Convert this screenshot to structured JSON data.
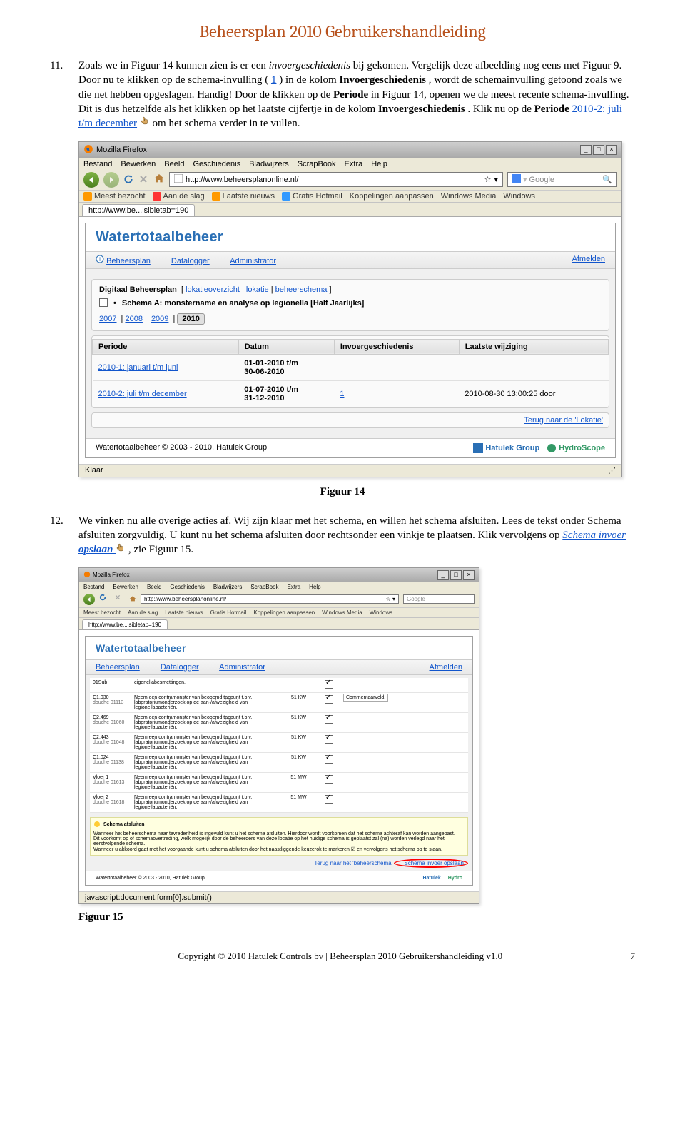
{
  "doc_title": "Beheersplan 2010 Gebruikershandleiding",
  "item11": {
    "num": "11.",
    "text_parts": {
      "p1": "Zoals we in Figuur 14 kunnen zien is er een ",
      "p2_italic": "invoergeschiedenis",
      "p3": " bij gekomen. Vergelijk deze afbeelding nog eens met Figuur 9. Door nu te klikken op de schema-invulling (",
      "p4_link": "1",
      "p5": ") in de kolom ",
      "p6_bold": "Invoergeschiedenis",
      "p7": ", wordt de schemainvulling getoond zoals we die net hebben opgeslagen. Handig! Door de klikken op de ",
      "p8_bold": "Periode",
      "p9": " in Figuur 14, openen we de meest recente schema-invulling. Dit is dus hetzelfde als het klikken op het laatste cijfertje in de kolom ",
      "p10_bold": "Invoergeschiedenis",
      "p11": ". Klik nu op de ",
      "p12_bold": "Periode ",
      "p13_link": "2010-2: juli t/m december",
      "p14": " om het schema verder in te vullen."
    }
  },
  "fig14": {
    "caption": "Figuur 14",
    "window_title": "Mozilla Firefox",
    "menus": [
      "Bestand",
      "Bewerken",
      "Beeld",
      "Geschiedenis",
      "Bladwijzers",
      "ScrapBook",
      "Extra",
      "Help"
    ],
    "url": "http://www.beheersplanonline.nl/",
    "search_placeholder": "Google",
    "bookmarks": [
      "Meest bezocht",
      "Aan de slag",
      "Laatste nieuws",
      "Gratis Hotmail",
      "Koppelingen aanpassen",
      "Windows Media",
      "Windows"
    ],
    "tab": "http://www.be...isibletab=190",
    "app_title": "Watertotaalbeheer",
    "nav_left": [
      "Beheersplan",
      "Datalogger",
      "Administrator"
    ],
    "nav_right": "Afmelden",
    "breadcrumb_label": "Digitaal Beheersplan",
    "breadcrumb_links": [
      "lokatieoverzicht",
      "lokatie",
      "beheerschema"
    ],
    "schema_bullet": "•",
    "schema_label": "Schema A: monstername en analyse op legionella [Half Jaarlijks]",
    "years_links": [
      "2007",
      "2008",
      "2009"
    ],
    "year_selected": "2010",
    "table": {
      "cols": [
        "Periode",
        "Datum",
        "Invoergeschiedenis",
        "Laatste wijziging"
      ],
      "rows": [
        {
          "periode": "2010-1: januari t/m juni",
          "datum": "01-01-2010 t/m\n30-06-2010",
          "inv": "",
          "laatste": ""
        },
        {
          "periode": "2010-2: juli t/m december",
          "datum": "01-07-2010 t/m\n31-12-2010",
          "inv": "1",
          "laatste": "2010-08-30 13:00:25 door"
        }
      ]
    },
    "return_link": "Terug naar de 'Lokatie'",
    "footer_copyright": "Watertotaalbeheer © 2003 - 2010, Hatulek Group",
    "brand1": "Hatulek Group",
    "brand2": "HydroScope",
    "status": "Klaar"
  },
  "item12": {
    "num": "12.",
    "text_parts": {
      "p1": "We vinken nu alle overige acties af. Wij zijn klaar met het schema, en willen het schema afsluiten. Lees de tekst onder Schema afsluiten zorgvuldig. U kunt nu het schema afsluiten door rechtsonder een vinkje te plaatsen. Klik vervolgens op ",
      "p2_link": "Schema invoer ",
      "p3_linkbold": "opslaan",
      "p4": ", zie Figuur 15."
    }
  },
  "fig15": {
    "caption": "Figuur 15",
    "window_title": "Mozilla Firefox",
    "menus": [
      "Bestand",
      "Bewerken",
      "Beeld",
      "Geschiedenis",
      "Bladwijzers",
      "ScrapBook",
      "Extra",
      "Help"
    ],
    "url": "http://www.beheersplanonline.nl/",
    "search_placeholder": "Google",
    "bookmarks": [
      "Meest bezocht",
      "Aan de slag",
      "Laatste nieuws",
      "Gratis Hotmail",
      "Koppelingen aanpassen",
      "Windows Media",
      "Windows"
    ],
    "tab": "http://www.be...isibletab=190",
    "app_title": "Watertotaalbeheer",
    "nav_left": [
      "Beheersplan",
      "Datalogger",
      "Administrator"
    ],
    "nav_right": "Afmelden",
    "rows": [
      {
        "code": "01Sub",
        "extra": "",
        "desc": "eigenellabesmettingen.",
        "val": "",
        "ch": true,
        "note": ""
      },
      {
        "code": "C1.030",
        "extra": "douche 01113",
        "desc": "Neem een contramonster van beooemd tappunt t.b.v. laboratoriumonderzoek op de aan-/afwezigheid van legionellabacteriën.",
        "val": "51  KW",
        "ch": true,
        "note": "Commentaarveld."
      },
      {
        "code": "C2.469",
        "extra": "douche 01060",
        "desc": "Neem een contramonster van beooemd tappunt t.b.v. laboratoriumonderzoek op de aan-/afwezigheid van legionellabacteriën.",
        "val": "51  KW",
        "ch": true,
        "note": ""
      },
      {
        "code": "C2.443",
        "extra": "douche 01048",
        "desc": "Neem een contramonster van beooemd tappunt t.b.v. laboratoriumonderzoek op de aan-/afwezigheid van legionellabacteriën.",
        "val": "51  KW",
        "ch": true,
        "note": ""
      },
      {
        "code": "C1.024",
        "extra": "douche 01138",
        "desc": "Neem een contramonster van beooemd tappunt t.b.v. laboratoriumonderzoek op de aan-/afwezigheid van legionellabacteriën.",
        "val": "51  KW",
        "ch": true,
        "note": ""
      },
      {
        "code": "Vloer 1",
        "extra": "douche 01613",
        "desc": "Neem een contramonster van beooemd tappunt t.b.v. laboratoriumonderzoek op de aan-/afwezigheid van legionellabacteriën.",
        "val": "51  MW",
        "ch": true,
        "note": ""
      },
      {
        "code": "Vloer 2",
        "extra": "douche 01618",
        "desc": "Neem een contramonster van beooemd tappunt t.b.v. laboratoriumonderzoek op de aan-/afwezigheid van legionellabacteriën.",
        "val": "51  MW",
        "ch": true,
        "note": ""
      }
    ],
    "schema_close_title": "Schema afsluiten",
    "schema_close_body": "Wanneer het beheerschema naar tevredenheid is ingevuld kunt u het schema afsluiten. Hierdoor wordt voorkomen dat het schema achteraf kan worden aangepast.\nDit voorkomt op of schemaovertreding, welk mogelijk door de beheerders van deze locatie op het huidige schema is geplaatst zal (na) worden verlegd naar het eerstvolgende schema.\nWanneer u akkoord gaat met het voorgaande kunt u schema afsluiten door het naastliggende keuzerok te markeren ☑ en vervolgens het schema op te slaan.",
    "schema_link1": "Terug naar het 'beheerschema'",
    "schema_link2": "Schema invoer opslaan",
    "footer_copyright": "Watertotaalbeheer © 2003 - 2010, Hatulek Group",
    "brand1": "Hatulek",
    "brand2": "Hydro",
    "status": "javascript:document.form[0].submit()"
  },
  "page_footer": {
    "left": "",
    "center": "Copyright © 2010 Hatulek Controls bv | Beheersplan 2010 Gebruikershandleiding v1.0",
    "right": "7"
  }
}
